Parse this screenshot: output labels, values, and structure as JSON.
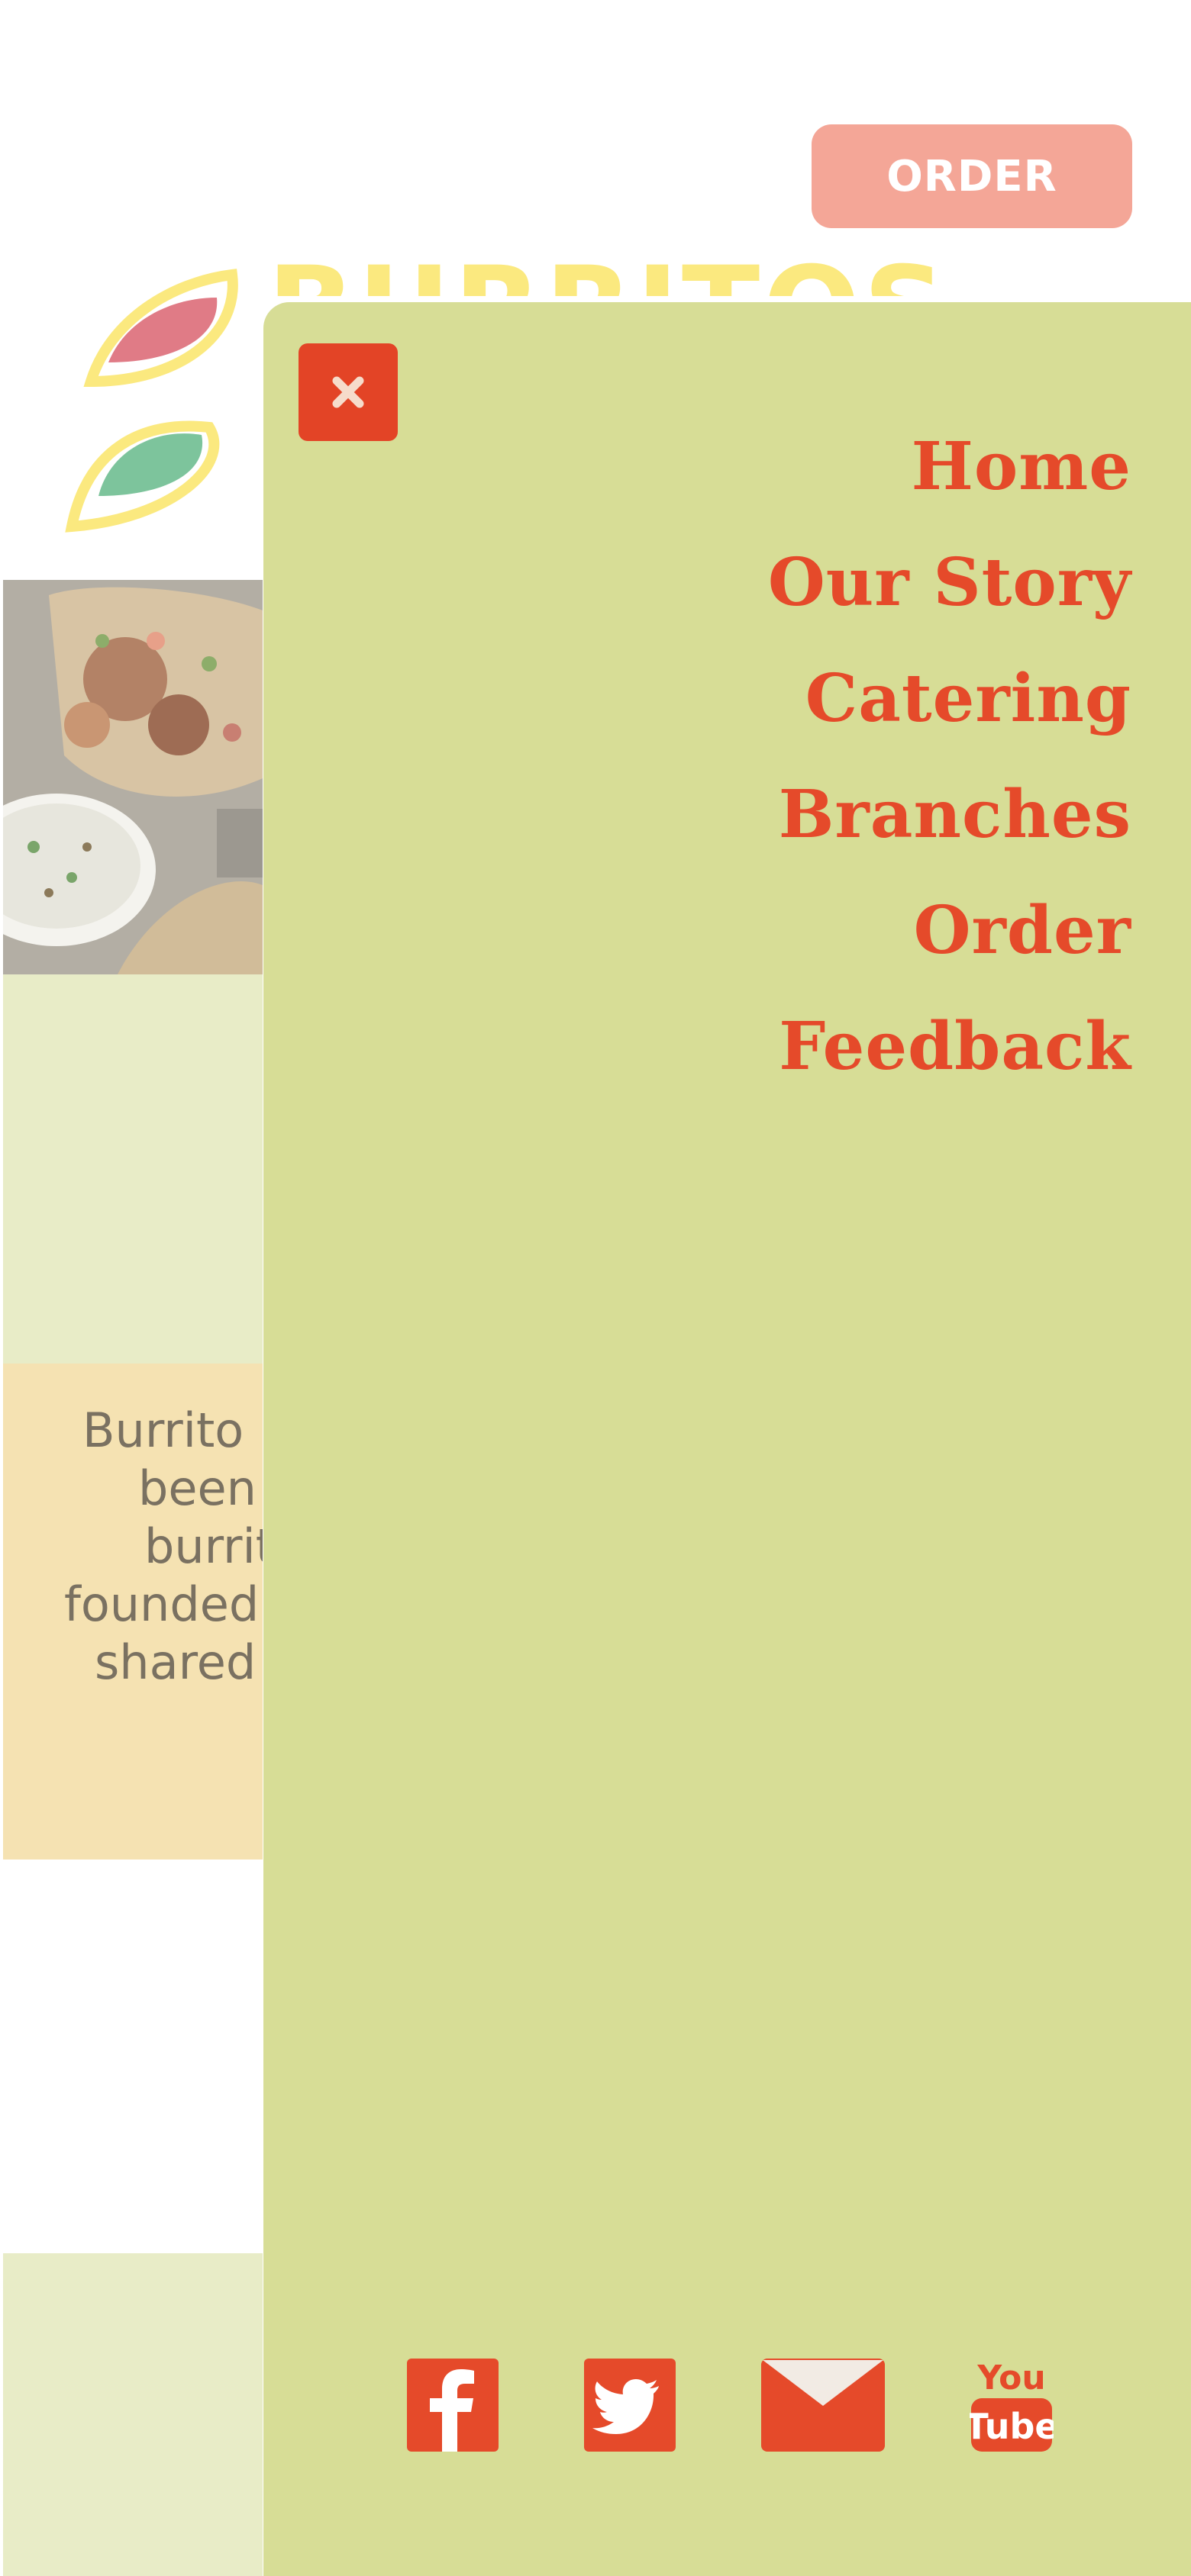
{
  "header": {
    "order_label": "ORDER",
    "brand_name": "BURRITOS"
  },
  "story": {
    "lines": [
      "Burrito B",
      "been",
      "burrit",
      "founded",
      "shared"
    ]
  },
  "menu": {
    "items": [
      {
        "label": "Home"
      },
      {
        "label": "Our Story"
      },
      {
        "label": "Catering"
      },
      {
        "label": "Branches"
      },
      {
        "label": "Order"
      },
      {
        "label": "Feedback"
      }
    ],
    "close_icon": "close-icon"
  },
  "socials": {
    "icons": [
      "facebook-icon",
      "twitter-icon",
      "email-icon",
      "youtube-icon"
    ],
    "youtube_top": "You",
    "youtube_bottom": "Tube"
  },
  "colors": {
    "drawer_bg": "#d7dd96",
    "accent_red": "#e54a2a",
    "order_button": "#f4a697",
    "brand_yellow": "#fbe97f",
    "story_bg": "#f5e2b2",
    "band_green": "#e8ecc7"
  }
}
